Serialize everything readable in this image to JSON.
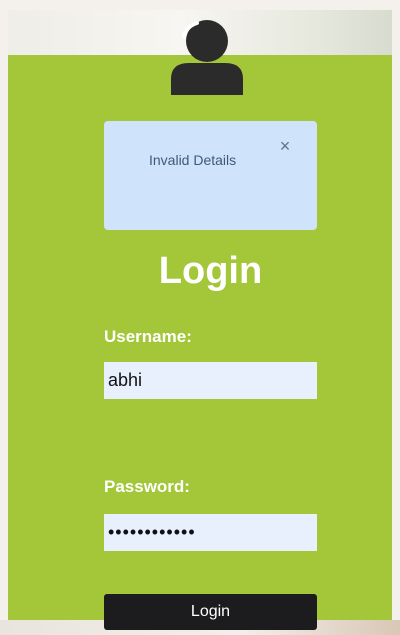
{
  "alert": {
    "message": "Invalid Details",
    "close_symbol": "×",
    "close_icon": "close-icon"
  },
  "form": {
    "title": "Login",
    "username_label": "Username:",
    "username_value": "abhi",
    "password_label": "Password:",
    "password_value": "••••••••••••",
    "submit_label": "Login"
  },
  "icons": {
    "avatar": "user-avatar-icon"
  },
  "colors": {
    "panel": "#a4c639",
    "alert_bg": "#cfe4fb",
    "input_bg": "#e8f0fe",
    "button_bg": "#1c1c1e"
  }
}
